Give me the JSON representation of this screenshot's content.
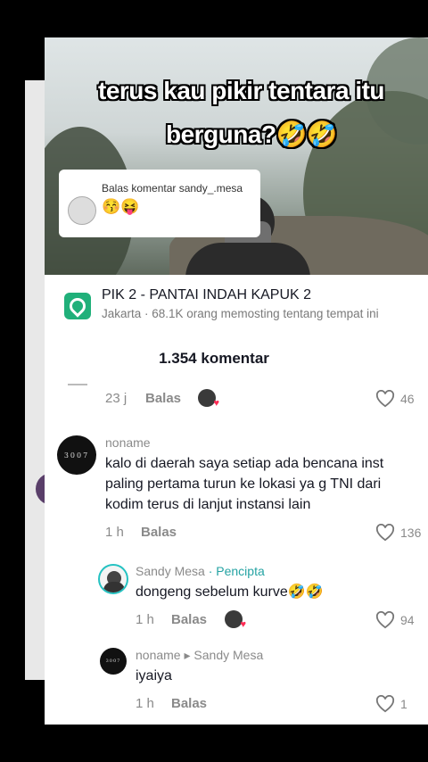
{
  "video": {
    "caption_line1": "terus kau pikir tentara itu",
    "caption_line2": "berguna?🤣🤣",
    "reply_box": {
      "title": "Balas komentar sandy_.mesa",
      "emojis": "😚😝"
    }
  },
  "location": {
    "title": "PIK 2 - PANTAI INDAH KAPUK 2",
    "subtitle": "Jakarta · 68.1K orang memosting tentang tempat ini"
  },
  "comments_header": "1.354 komentar",
  "reply_label": "Balas",
  "comments": [
    {
      "time": "23 j",
      "likes": "46"
    },
    {
      "avatar_text": "3007",
      "name": "noname",
      "lines": [
        "kalo di daerah saya setiap ada bencana inst",
        "paling pertama turun ke lokasi ya g TNI dari",
        "kodim terus di lanjut instansi lain"
      ],
      "time": "1 h",
      "likes": "136"
    },
    {
      "name": "Sandy Mesa",
      "badge": "· Pencipta",
      "text": "dongeng sebelum kurve🤣🤣",
      "time": "1 h",
      "likes": "94"
    },
    {
      "avatar_text": "3007",
      "name": "noname",
      "arrow": "▸",
      "reply_to": "Sandy Mesa",
      "text": "iyaiya",
      "time": "1 h",
      "likes": "1"
    }
  ],
  "colors": {
    "accent_teal": "#25a3a3",
    "location_green": "#20b07a",
    "heart": "#fe2c55"
  }
}
